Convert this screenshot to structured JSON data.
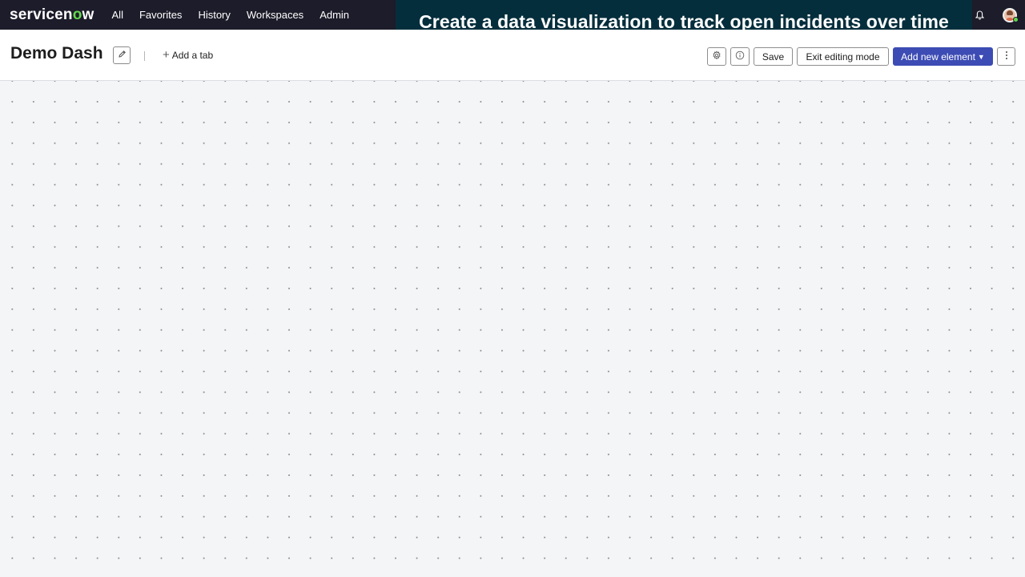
{
  "nav": {
    "logo_parts": [
      "servicen",
      "o",
      "w"
    ],
    "items": [
      "All",
      "Favorites",
      "History",
      "Workspaces",
      "Admin"
    ]
  },
  "banner": {
    "text": "Create a data visualization to track open incidents over time"
  },
  "dashboard": {
    "title": "Demo Dash",
    "add_tab_label": "Add a tab",
    "buttons": {
      "save": "Save",
      "exit": "Exit editing mode",
      "add_element": "Add new element"
    }
  },
  "colors": {
    "nav_bg": "#1c1c2a",
    "logo_accent": "#62d84e",
    "banner_bg": "#052e3c",
    "banner_accent": "#5bd35a",
    "primary_button": "#3d4cb4",
    "canvas_bg": "#f4f5f7"
  },
  "icons": {
    "header": [
      "pencil-icon",
      "gear-icon",
      "info-icon",
      "kebab-icon"
    ],
    "nav": [
      "bell-icon",
      "avatar"
    ]
  }
}
